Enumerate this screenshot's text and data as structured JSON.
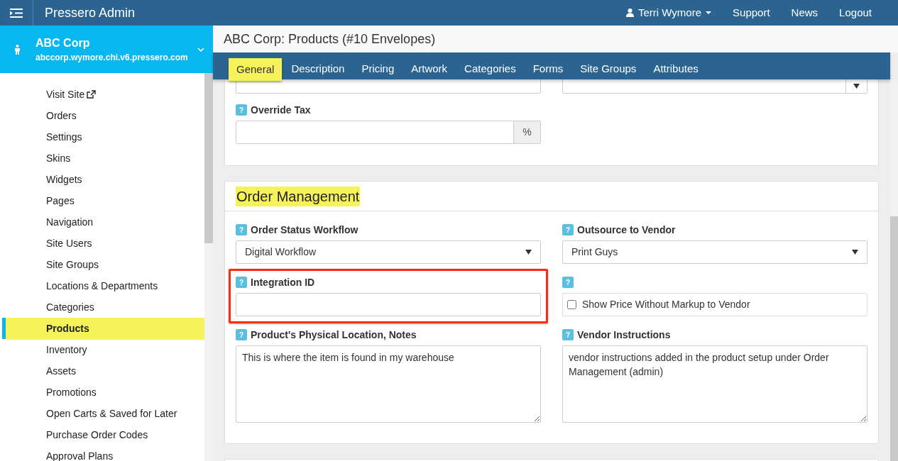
{
  "topbar": {
    "title": "Pressero Admin",
    "user": "Terri Wymore",
    "links": [
      "Support",
      "News",
      "Logout"
    ]
  },
  "site": {
    "name": "ABC Corp",
    "url": "abccorp.wymore.chi.v6.pressero.com"
  },
  "sidebar": {
    "items": [
      {
        "label": "Visit Site",
        "kind": "external",
        "selected": false
      },
      {
        "label": "Orders",
        "kind": "link",
        "selected": false
      },
      {
        "label": "Settings",
        "kind": "link",
        "selected": false
      },
      {
        "label": "Skins",
        "kind": "link",
        "selected": false
      },
      {
        "label": "Widgets",
        "kind": "link",
        "selected": false
      },
      {
        "label": "Pages",
        "kind": "link",
        "selected": false
      },
      {
        "label": "Navigation",
        "kind": "link",
        "selected": false
      },
      {
        "label": "Site Users",
        "kind": "link",
        "selected": false
      },
      {
        "label": "Site Groups",
        "kind": "link",
        "selected": false
      },
      {
        "label": "Locations & Departments",
        "kind": "link",
        "selected": false
      },
      {
        "label": "Categories",
        "kind": "link",
        "selected": false
      },
      {
        "label": "Products",
        "kind": "link",
        "selected": true
      },
      {
        "label": "Inventory",
        "kind": "link",
        "selected": false
      },
      {
        "label": "Assets",
        "kind": "link",
        "selected": false
      },
      {
        "label": "Promotions",
        "kind": "link",
        "selected": false
      },
      {
        "label": "Open Carts & Saved for Later",
        "kind": "link",
        "selected": false
      },
      {
        "label": "Purchase Order Codes",
        "kind": "link",
        "selected": false
      },
      {
        "label": "Approval Plans",
        "kind": "link",
        "selected": false
      }
    ]
  },
  "page": {
    "title": "ABC Corp: Products (#10 Envelopes)"
  },
  "tabs": [
    {
      "label": "General",
      "selected": true
    },
    {
      "label": "Description",
      "selected": false
    },
    {
      "label": "Pricing",
      "selected": false
    },
    {
      "label": "Artwork",
      "selected": false
    },
    {
      "label": "Categories",
      "selected": false
    },
    {
      "label": "Forms",
      "selected": false
    },
    {
      "label": "Site Groups",
      "selected": false
    },
    {
      "label": "Attributes",
      "selected": false
    }
  ],
  "tax_card": {
    "fields": [
      {
        "kind": "addon",
        "help": "?",
        "label": "Override Tax",
        "addon": "%",
        "highlighted": false
      }
    ]
  },
  "order_card": {
    "title": "Order Management",
    "left": [
      {
        "kind": "select",
        "help": "?",
        "label": "Order Status Workflow",
        "value": "Digital Workflow",
        "highlighted": false
      },
      {
        "kind": "input",
        "help": "?",
        "label": "Integration ID",
        "highlighted": true
      },
      {
        "kind": "textarea",
        "help": "?",
        "label": "Product's Physical Location, Notes",
        "value": "This is where the item is found in my warehouse",
        "highlighted": false
      }
    ],
    "right": [
      {
        "kind": "select",
        "help": "?",
        "label": "Outsource to Vendor",
        "value": "Print Guys",
        "highlighted": false
      },
      {
        "kind": "checkbox",
        "help": "?",
        "label": "Show Price Without Markup to Vendor",
        "checked": false,
        "highlighted": false
      },
      {
        "kind": "textarea",
        "help": "?",
        "label": "Vendor Instructions",
        "value": "vendor instructions added in the product setup under Order Management (admin)",
        "highlighted": false
      }
    ]
  }
}
